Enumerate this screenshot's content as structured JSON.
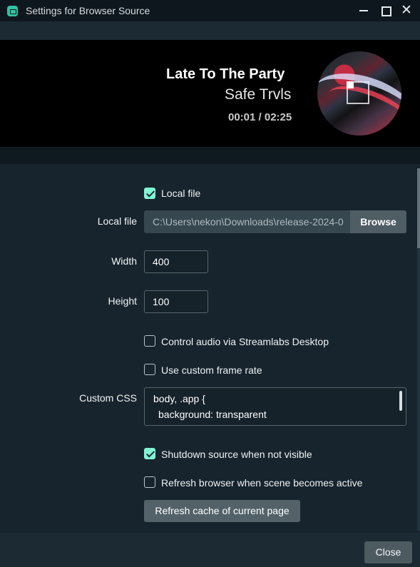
{
  "window": {
    "title": "Settings for Browser Source",
    "icon": "streamlabs-icon",
    "controls": [
      "minimize-icon",
      "maximize-icon",
      "close-icon"
    ],
    "close_glyph": "✕"
  },
  "preview": {
    "track_title": "Late To The Party",
    "artist": "Safe Trvls",
    "time": "00:01 / 02:25",
    "artwork_icon": "album-art-icon",
    "play_icon": "play-square-icon"
  },
  "form": {
    "local_file_checkbox": {
      "label": "Local file",
      "checked": true
    },
    "local_file": {
      "label": "Local file",
      "value": "C:\\Users\\nekon\\Downloads\\release-2024-0",
      "button": "Browse"
    },
    "width": {
      "label": "Width",
      "value": "400"
    },
    "height": {
      "label": "Height",
      "value": "100"
    },
    "control_audio": {
      "label": "Control audio via Streamlabs Desktop",
      "checked": false
    },
    "custom_frame_rate": {
      "label": "Use custom frame rate",
      "checked": false
    },
    "custom_css": {
      "label": "Custom CSS",
      "line1": "body, .app {",
      "line2": "background: transparent"
    },
    "shutdown_source": {
      "label": "Shutdown source when not visible",
      "checked": true
    },
    "refresh_browser": {
      "label": "Refresh browser when scene becomes active",
      "checked": false
    },
    "refresh_cache_button": "Refresh cache of current page"
  },
  "footer": {
    "close_button": "Close"
  },
  "colors": {
    "background": "#17242d",
    "accent_teal": "#80f5d2",
    "titlebar": "#0e171d",
    "button_gray": "#4f5e65"
  }
}
